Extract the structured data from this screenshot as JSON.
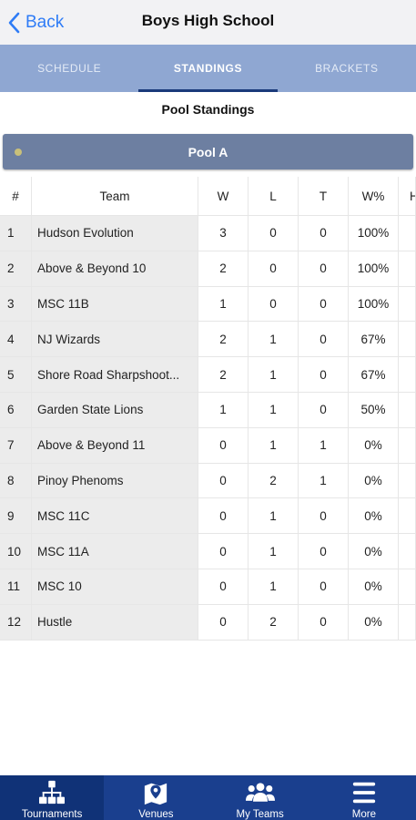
{
  "nav": {
    "back_label": "Back",
    "title": "Boys High School"
  },
  "tabs": [
    {
      "label": "SCHEDULE",
      "active": false
    },
    {
      "label": "STANDINGS",
      "active": true
    },
    {
      "label": "BRACKETS",
      "active": false
    }
  ],
  "section_title": "Pool Standings",
  "pool": {
    "name": "Pool A",
    "dot_color": "#c9c07a"
  },
  "table": {
    "headers": {
      "num": "#",
      "team": "Team",
      "w": "W",
      "l": "L",
      "t": "T",
      "pct": "W%",
      "extra": "H"
    },
    "rows": [
      {
        "num": "1",
        "team": "Hudson Evolution",
        "w": "3",
        "l": "0",
        "t": "0",
        "pct": "100%"
      },
      {
        "num": "2",
        "team": "Above & Beyond 10",
        "w": "2",
        "l": "0",
        "t": "0",
        "pct": "100%"
      },
      {
        "num": "3",
        "team": "MSC 11B",
        "w": "1",
        "l": "0",
        "t": "0",
        "pct": "100%"
      },
      {
        "num": "4",
        "team": "NJ Wizards",
        "w": "2",
        "l": "1",
        "t": "0",
        "pct": "67%"
      },
      {
        "num": "5",
        "team": "Shore Road Sharpshoot...",
        "w": "2",
        "l": "1",
        "t": "0",
        "pct": "67%"
      },
      {
        "num": "6",
        "team": "Garden State Lions",
        "w": "1",
        "l": "1",
        "t": "0",
        "pct": "50%"
      },
      {
        "num": "7",
        "team": "Above & Beyond 11",
        "w": "0",
        "l": "1",
        "t": "1",
        "pct": "0%"
      },
      {
        "num": "8",
        "team": "Pinoy Phenoms",
        "w": "0",
        "l": "2",
        "t": "1",
        "pct": "0%"
      },
      {
        "num": "9",
        "team": "MSC 11C",
        "w": "0",
        "l": "1",
        "t": "0",
        "pct": "0%"
      },
      {
        "num": "10",
        "team": "MSC 11A",
        "w": "0",
        "l": "1",
        "t": "0",
        "pct": "0%"
      },
      {
        "num": "11",
        "team": "MSC 10",
        "w": "0",
        "l": "1",
        "t": "0",
        "pct": "0%"
      },
      {
        "num": "12",
        "team": "Hustle",
        "w": "0",
        "l": "2",
        "t": "0",
        "pct": "0%"
      }
    ]
  },
  "tabbar": [
    {
      "label": "Tournaments",
      "icon": "tournament-icon",
      "active": true
    },
    {
      "label": "Venues",
      "icon": "map-icon",
      "active": false
    },
    {
      "label": "My Teams",
      "icon": "team-icon",
      "active": false
    },
    {
      "label": "More",
      "icon": "menu-icon",
      "active": false
    }
  ],
  "colors": {
    "accent": "#2f7cf6",
    "tab_bg": "#8fa7d2",
    "pool_bg": "#6d7fa1",
    "tabbar_bg": "#1a3f8e"
  }
}
